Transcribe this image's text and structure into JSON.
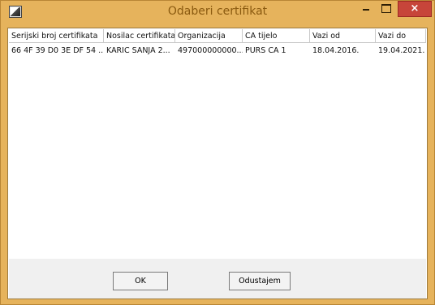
{
  "window": {
    "title": "Odaberi certifikat",
    "close_glyph": "×"
  },
  "table": {
    "columns": [
      "Serijski broj certifikata",
      "Nosilac certifikata",
      "Organizacija",
      "CA tijelo",
      "Vazi od",
      "Vazi do"
    ],
    "rows": [
      [
        "66 4F 39 D0 3E DF 54 ...",
        "KARIC SANJA 2...",
        "497000000000...",
        "PURS CA 1",
        "18.04.2016.",
        "19.04.2021."
      ]
    ]
  },
  "buttons": {
    "ok_label": "OK",
    "cancel_label": "Odustajem"
  },
  "colors": {
    "titlebar": "#e6b35c",
    "close_button": "#c7453a"
  },
  "icons": {
    "app": "app-icon",
    "minimize": "minimize-icon",
    "maximize": "maximize-icon",
    "close": "close-icon"
  }
}
